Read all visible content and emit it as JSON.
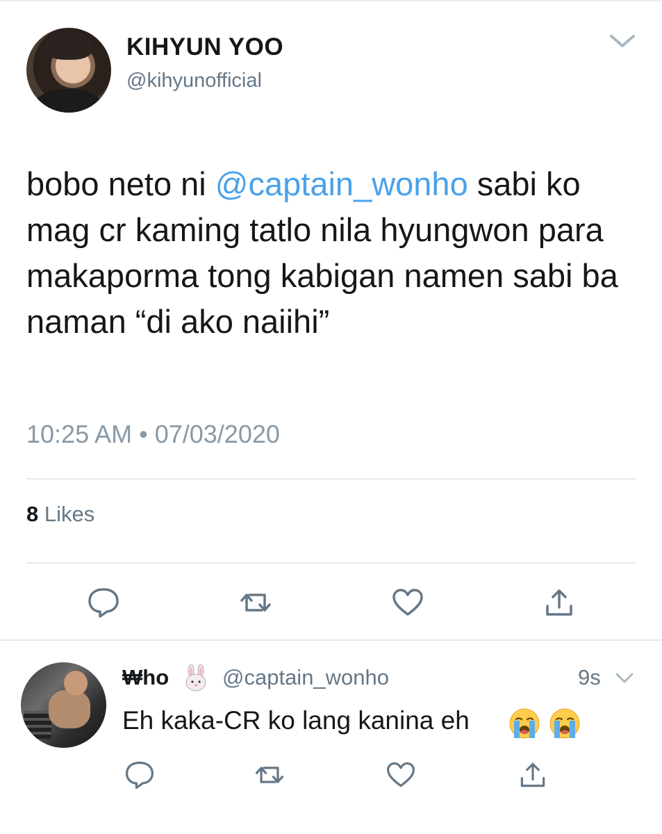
{
  "main_tweet": {
    "display_name": "KIHYUN YOO",
    "handle": "@kihyunofficial",
    "text_before_mention": "bobo neto ni ",
    "mention": "@captain_wonho",
    "text_after_mention": " sabi ko mag cr kaming tatlo nila hyungwon para makaporma tong kabigan namen sabi ba naman “di ako naiihi”",
    "timestamp": "10:25 AM • 07/03/2020",
    "likes_count": "8",
    "likes_label": "Likes",
    "icons": {
      "menu": "chevron-down-icon",
      "reply": "reply-icon",
      "retweet": "retweet-icon",
      "like": "heart-icon",
      "share": "share-icon"
    }
  },
  "reply_tweet": {
    "display_name": "₩ho",
    "name_emoji": "rabbit-face-emoji",
    "handle": "@captain_wonho",
    "time": "9s",
    "text": "Eh kaka-CR ko lang kanina eh",
    "emojis": [
      "loudly-crying-face-emoji",
      "loudly-crying-face-emoji"
    ]
  },
  "colors": {
    "text": "#14171a",
    "secondary": "#657786",
    "timestamp": "#8899a6",
    "mention": "#4aa1eb",
    "divider": "#e1e8ed",
    "icon": "#657786"
  }
}
